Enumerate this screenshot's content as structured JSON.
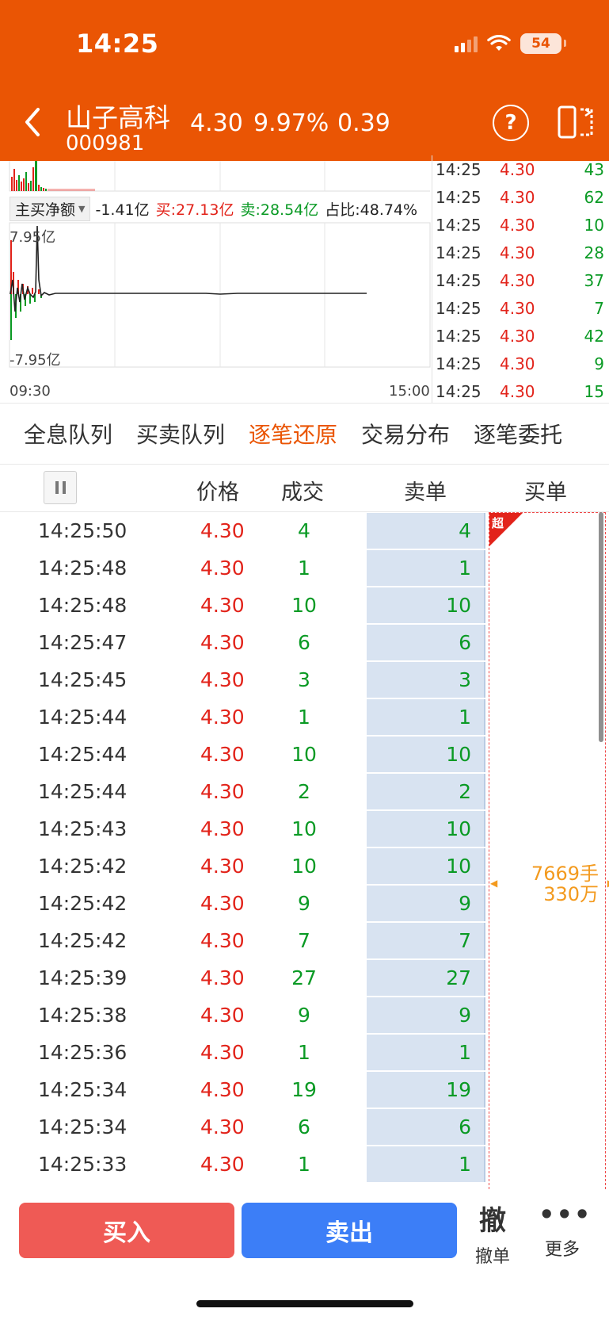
{
  "status_bar": {
    "time": "14:25",
    "battery": "54"
  },
  "stock": {
    "name": "山子高科",
    "code": "000981",
    "price": "4.30",
    "change_pct": "9.97%",
    "change": "0.39"
  },
  "header": {
    "help_icon": "?"
  },
  "chart": {
    "top_label": "7.95亿",
    "bottom_label": "-7.95亿",
    "x_start": "09:30",
    "x_end": "15:00",
    "net_select": "主买净额",
    "net_value": "-1.41亿",
    "buy_amount": "买:27.13亿",
    "sell_amount": "卖:28.54亿",
    "ratio": "占比:48.74%"
  },
  "tick_list": [
    {
      "time": "14:25",
      "price": "4.30",
      "vol": "43"
    },
    {
      "time": "14:25",
      "price": "4.30",
      "vol": "62"
    },
    {
      "time": "14:25",
      "price": "4.30",
      "vol": "10"
    },
    {
      "time": "14:25",
      "price": "4.30",
      "vol": "28"
    },
    {
      "time": "14:25",
      "price": "4.30",
      "vol": "37"
    },
    {
      "time": "14:25",
      "price": "4.30",
      "vol": "7"
    },
    {
      "time": "14:25",
      "price": "4.30",
      "vol": "42"
    },
    {
      "time": "14:25",
      "price": "4.30",
      "vol": "9"
    },
    {
      "time": "14:25",
      "price": "4.30",
      "vol": "15"
    }
  ],
  "tabs": [
    "全息队列",
    "买卖队列",
    "逐笔还原",
    "交易分布",
    "逐笔委托"
  ],
  "active_tab": 2,
  "table": {
    "headers": {
      "price": "价格",
      "volume": "成交",
      "sell": "卖单",
      "buy": "买单"
    },
    "rows": [
      {
        "time": "14:25:50",
        "price": "4.30",
        "vol": "4",
        "sell": "4"
      },
      {
        "time": "14:25:48",
        "price": "4.30",
        "vol": "1",
        "sell": "1"
      },
      {
        "time": "14:25:48",
        "price": "4.30",
        "vol": "10",
        "sell": "10"
      },
      {
        "time": "14:25:47",
        "price": "4.30",
        "vol": "6",
        "sell": "6"
      },
      {
        "time": "14:25:45",
        "price": "4.30",
        "vol": "3",
        "sell": "3"
      },
      {
        "time": "14:25:44",
        "price": "4.30",
        "vol": "1",
        "sell": "1"
      },
      {
        "time": "14:25:44",
        "price": "4.30",
        "vol": "10",
        "sell": "10"
      },
      {
        "time": "14:25:44",
        "price": "4.30",
        "vol": "2",
        "sell": "2"
      },
      {
        "time": "14:25:43",
        "price": "4.30",
        "vol": "10",
        "sell": "10"
      },
      {
        "time": "14:25:42",
        "price": "4.30",
        "vol": "10",
        "sell": "10"
      },
      {
        "time": "14:25:42",
        "price": "4.30",
        "vol": "9",
        "sell": "9"
      },
      {
        "time": "14:25:42",
        "price": "4.30",
        "vol": "7",
        "sell": "7"
      },
      {
        "time": "14:25:39",
        "price": "4.30",
        "vol": "27",
        "sell": "27"
      },
      {
        "time": "14:25:38",
        "price": "4.30",
        "vol": "9",
        "sell": "9"
      },
      {
        "time": "14:25:36",
        "price": "4.30",
        "vol": "1",
        "sell": "1"
      },
      {
        "time": "14:25:34",
        "price": "4.30",
        "vol": "19",
        "sell": "19"
      },
      {
        "time": "14:25:34",
        "price": "4.30",
        "vol": "6",
        "sell": "6"
      },
      {
        "time": "14:25:33",
        "price": "4.30",
        "vol": "1",
        "sell": "1"
      }
    ],
    "buy_badge": "超",
    "buy_summary_lots": "7669手",
    "buy_summary_amount": "330万"
  },
  "bottom": {
    "buy_label": "买入",
    "sell_label": "卖出",
    "cancel_icon": "撤",
    "cancel_label": "撤单",
    "more_icon": "•••",
    "more_label": "更多"
  },
  "colors": {
    "header": "#ea5504",
    "up": "#e2231a",
    "down": "#0a9a24",
    "sell_cell": "#d8e3f1",
    "buy_btn": "#ef5a55",
    "sell_btn": "#3c7ef7",
    "summary": "#f39a1e"
  }
}
